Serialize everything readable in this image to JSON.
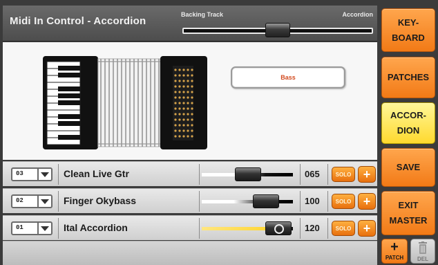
{
  "header": {
    "title": "Midi In Control - Accordion",
    "balance_left_label": "Backing Track",
    "balance_right_label": "Accordion"
  },
  "instrument": {
    "icon": "accordion-icon",
    "bass_button_label": "Bass"
  },
  "rows": [
    {
      "channel": "03",
      "patch": "Clean Live Gtr",
      "volume": "065",
      "solo_label": "SOLO",
      "add_label": "+"
    },
    {
      "channel": "02",
      "patch": "Finger Okybass",
      "volume": "100",
      "solo_label": "SOLO",
      "add_label": "+"
    },
    {
      "channel": "01",
      "patch": "Ital Accordion",
      "volume": "120",
      "solo_label": "SOLO",
      "add_label": "+"
    }
  ],
  "side_buttons": {
    "keyboard": "KEY-\nBOARD",
    "patches": "PATCHES",
    "accordion": "ACCOR-\nDION",
    "save": "SAVE",
    "exit_master": "EXIT\nMASTER",
    "patch_label": "PATCH",
    "patch_plus": "+",
    "del_label": "DEL"
  },
  "colors": {
    "accent_orange": "#f58a24",
    "active_yellow": "#ffe34d",
    "bass_text": "#d24a1e"
  }
}
